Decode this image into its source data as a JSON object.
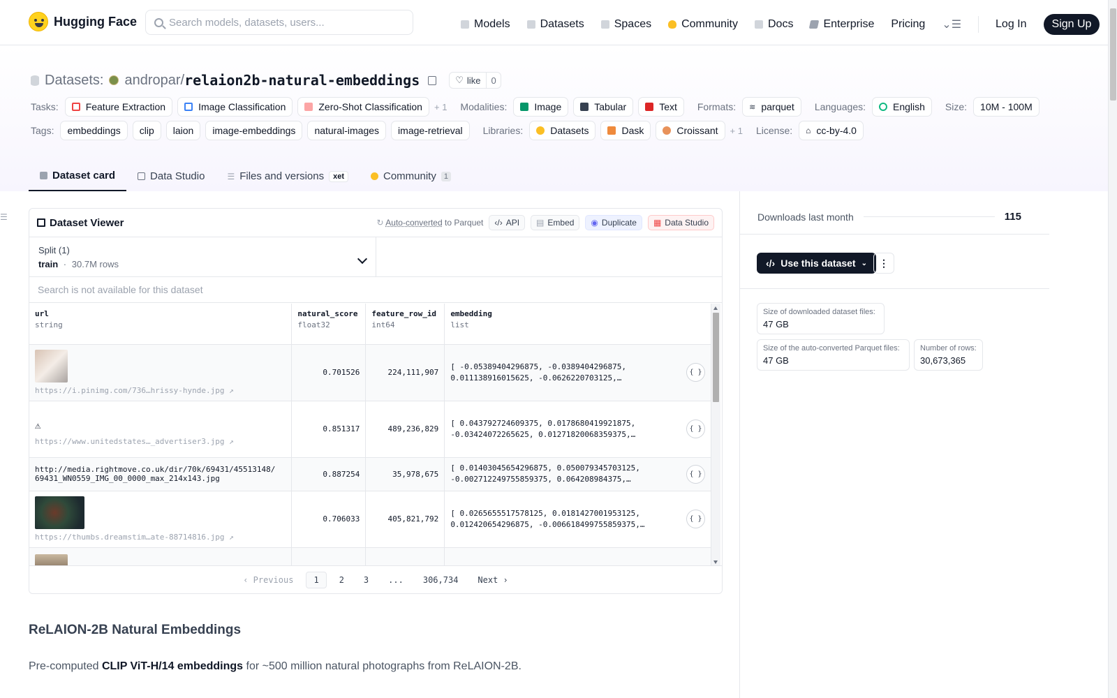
{
  "nav": {
    "logo_text": "Hugging Face",
    "search_placeholder": "Search models, datasets, users...",
    "links": [
      "Models",
      "Datasets",
      "Spaces",
      "Community",
      "Docs",
      "Enterprise",
      "Pricing"
    ],
    "login": "Log In",
    "signup": "Sign Up"
  },
  "repo": {
    "type_label": "Datasets:",
    "owner": "andropar",
    "separator": "/",
    "name": "relaion2b-natural-embeddings",
    "like_label": "like",
    "like_count": "0"
  },
  "meta": {
    "tasks_label": "Tasks:",
    "tasks": [
      "Feature Extraction",
      "Image Classification",
      "Zero-Shot Classification"
    ],
    "tasks_more": "+ 1",
    "modalities_label": "Modalities:",
    "modalities": [
      "Image",
      "Tabular",
      "Text"
    ],
    "formats_label": "Formats:",
    "formats": [
      "parquet"
    ],
    "languages_label": "Languages:",
    "languages": [
      "English"
    ],
    "size_label": "Size:",
    "size": "10M - 100M",
    "tags_label": "Tags:",
    "tags": [
      "embeddings",
      "clip",
      "laion",
      "image-embeddings",
      "natural-images",
      "image-retrieval"
    ],
    "libraries_label": "Libraries:",
    "libraries": [
      "Datasets",
      "Dask",
      "Croissant"
    ],
    "libraries_more": "+ 1",
    "license_label": "License:",
    "license": "cc-by-4.0"
  },
  "tabs": {
    "dataset_card": "Dataset card",
    "data_studio": "Data Studio",
    "files": "Files and versions",
    "xet": "xet",
    "community": "Community",
    "community_count": "1"
  },
  "viewer": {
    "title": "Dataset Viewer",
    "auto_converted": "Auto-converted",
    "to_parquet": "to Parquet",
    "api": "API",
    "embed": "Embed",
    "duplicate": "Duplicate",
    "data_studio": "Data Studio",
    "split_label": "Split (1)",
    "split_name": "train",
    "split_dot": "·",
    "split_rows": "30.7M rows",
    "search_note": "Search is not available for this dataset",
    "columns": [
      {
        "name": "url",
        "type": "string"
      },
      {
        "name": "natural_score",
        "type": "float32"
      },
      {
        "name": "feature_row_id",
        "type": "int64"
      },
      {
        "name": "embedding",
        "type": "list"
      }
    ],
    "rows": [
      {
        "url": "https://i.pinimg.com/736…hrissy-hynde.jpg ↗",
        "score": "0.701526",
        "row_id": "224,111,907",
        "emb1": "[ -0.05389404296875, -0.0389404296875,",
        "emb2": "0.011138916015625, -0.0626220703125,…"
      },
      {
        "url": "https://www.unitedstates…_advertiser3.jpg ↗",
        "score": "0.851317",
        "row_id": "489,236,829",
        "emb1": "[ 0.043792724609375, 0.0178680419921875,",
        "emb2": "-0.03424072265625, 0.01271820068359375,…"
      },
      {
        "url1": "http://media.rightmove.co.uk/dir/70k/69431/45513148/",
        "url2": "69431_WN0559_IMG_00_0000_max_214x143.jpg",
        "score": "0.887254",
        "row_id": "35,978,675",
        "emb1": "[ 0.01403045654296875, 0.050079345703125,",
        "emb2": "-0.002712249755859375, 0.064208984375,…"
      },
      {
        "url": "https://thumbs.dreamstim…ate-88714816.jpg ↗",
        "score": "0.706033",
        "row_id": "405,821,792",
        "emb1": "[ 0.0265655517578125, 0.0181427001953125,",
        "emb2": "0.012420654296875, -0.006618499755859375,…"
      }
    ],
    "warn_glyph": "⚠",
    "json_glyph": "{ }",
    "pager": {
      "prev": "Previous",
      "pages": [
        "1",
        "2",
        "3",
        "...",
        "306,734"
      ],
      "next": "Next"
    }
  },
  "readme": {
    "title": "ReLAION-2B Natural Embeddings",
    "p_pre": "Pre-computed ",
    "p_bold": "CLIP ViT-H/14 embeddings",
    "p_post": " for ~500 million natural photographs from ReLAION-2B."
  },
  "sidebar": {
    "downloads_label": "Downloads last month",
    "downloads_value": "115",
    "use_button": "Use this dataset",
    "kebab": "⋮",
    "size_downloaded_label": "Size of downloaded dataset files:",
    "size_downloaded": "47 GB",
    "size_parquet_label": "Size of the auto-converted Parquet files:",
    "size_parquet": "47 GB",
    "num_rows_label": "Number of rows:",
    "num_rows": "30,673,365"
  }
}
